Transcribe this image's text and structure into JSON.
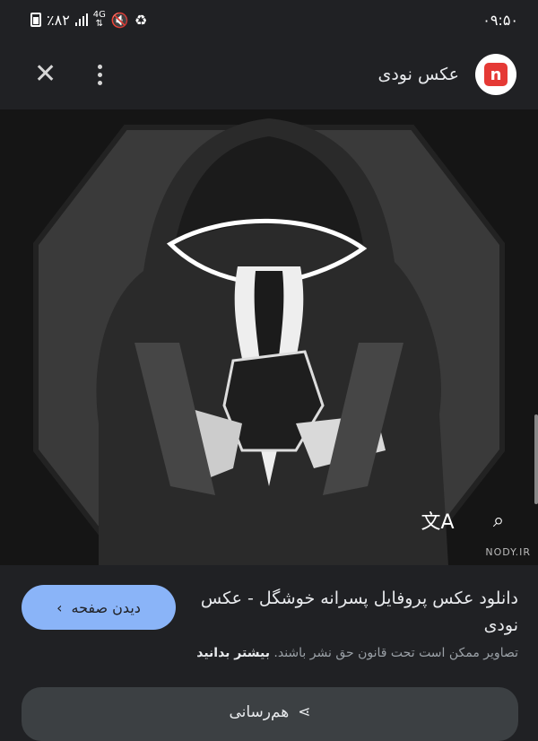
{
  "status_bar": {
    "time": "۰۹:۵۰",
    "battery": "٪۸۲",
    "network": "4G"
  },
  "app_bar": {
    "site_name": "عکس نودی",
    "logo_letter": "n"
  },
  "image": {
    "watermark": "NODY.IR"
  },
  "info": {
    "view_page": "دیدن صفحه",
    "title": "دانلود عکس پروفایل پسرانه خوشگل - عکس نودی",
    "copyright_text": "تصاویر ممکن است تحت قانون حق نشر باشند.",
    "learn_more": "بیشتر بدانید",
    "share": "هم‌رسانی"
  },
  "colors": {
    "accent": "#8ab4f8",
    "background": "#202124",
    "logo_red": "#e53935"
  }
}
